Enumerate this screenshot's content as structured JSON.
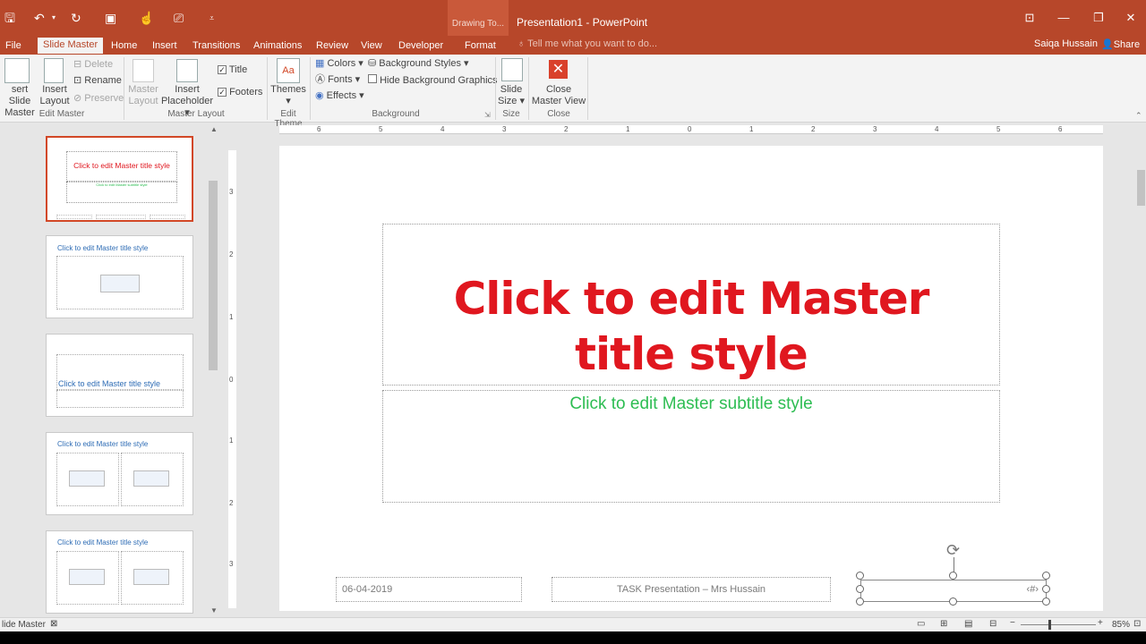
{
  "titlebar": {
    "context_label": "Drawing To...",
    "title": "Presentation1 - PowerPoint"
  },
  "tabs": [
    "File",
    "Slide Master",
    "Home",
    "Insert",
    "Transitions",
    "Animations",
    "Review",
    "View",
    "Developer",
    "Format"
  ],
  "tell_me": "Tell me what you want to do...",
  "user": "Saiqa Hussain",
  "share": "Share",
  "ribbon": {
    "insert_slide_master_1": "sert Slide",
    "insert_slide_master_2": "Master",
    "insert_layout_1": "Insert",
    "insert_layout_2": "Layout",
    "delete": "Delete",
    "rename": "Rename",
    "preserve": "Preserve",
    "master_layout_1": "Master",
    "master_layout_2": "Layout",
    "insert_placeholder_1": "Insert",
    "insert_placeholder_2": "Placeholder",
    "title_cb": "Title",
    "footers_cb": "Footers",
    "themes": "Themes",
    "colors": "Colors",
    "fonts": "Fonts",
    "effects": "Effects",
    "background_styles": "Background Styles",
    "hide_bg_graphics": "Hide Background Graphics",
    "slide_size_1": "Slide",
    "slide_size_2": "Size",
    "close_master_1": "Close",
    "close_master_2": "Master View",
    "groups": {
      "edit_master": "Edit Master",
      "master_layout": "Master Layout",
      "edit_theme": "Edit Theme",
      "background": "Background",
      "size": "Size",
      "close": "Close"
    }
  },
  "thumbs": {
    "t1_title": "Click to edit Master title style",
    "t1_sub": "Click to edit Master subtitle style",
    "t2_title": "Click to edit Master title style",
    "t3_title": "Click to edit Master title style",
    "t4_title": "Click to edit Master title style",
    "t5_title": "Click to edit Master title style"
  },
  "slide": {
    "title": "Click to edit Master title style",
    "subtitle": "Click to edit Master subtitle style",
    "date": "06-04-2019",
    "footer": "TASK Presentation – Mrs Hussain",
    "slide_number": "‹#›"
  },
  "ruler_h_labels": [
    "6",
    "5",
    "4",
    "3",
    "2",
    "1",
    "0",
    "1",
    "2",
    "3",
    "4",
    "5",
    "6"
  ],
  "ruler_v_labels": [
    "3",
    "2",
    "1",
    "0",
    "1",
    "2",
    "3"
  ],
  "status": {
    "view": "lide Master",
    "zoom": "85%"
  }
}
